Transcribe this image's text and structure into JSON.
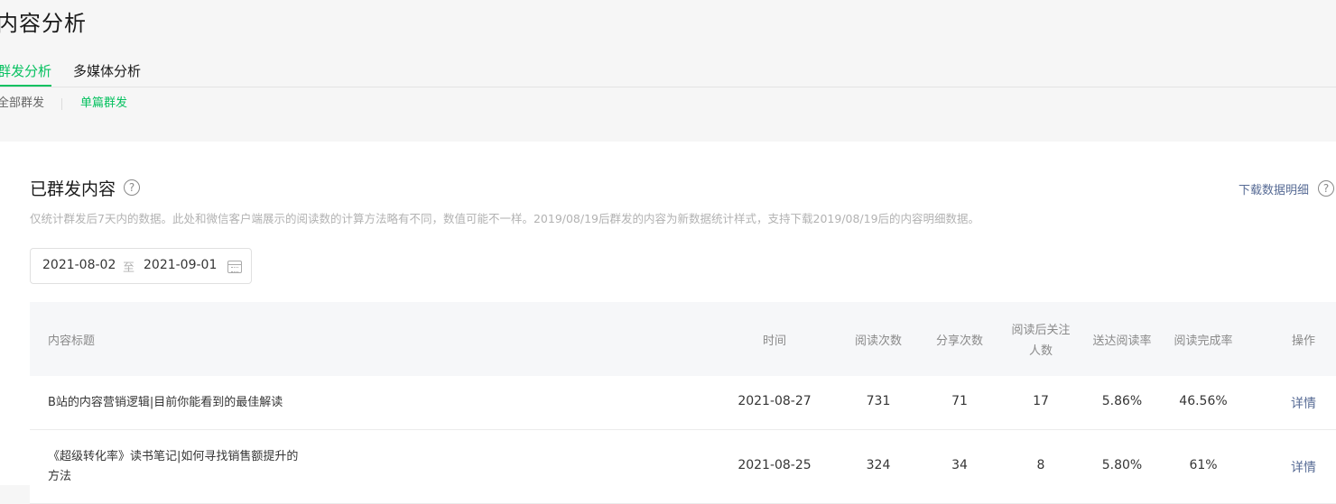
{
  "page_title": "内容分析",
  "tabs": [
    {
      "label": "群发分析",
      "active": true
    },
    {
      "label": "多媒体分析",
      "active": false
    }
  ],
  "subtabs": [
    {
      "label": "全部群发",
      "active": false
    },
    {
      "label": "单篇群发",
      "active": true
    }
  ],
  "section": {
    "title": "已群发内容",
    "download_label": "下载数据明细",
    "note": "仅统计群发后7天内的数据。此处和微信客户端展示的阅读数的计算方法略有不同，数值可能不一样。2019/08/19后群发的内容为新数据统计样式，支持下载2019/08/19后的内容明细数据。"
  },
  "date_range": {
    "start": "2021-08-02",
    "separator": "至",
    "end": "2021-09-01"
  },
  "table": {
    "headers": {
      "title": "内容标题",
      "time": "时间",
      "reads": "阅读次数",
      "shares": "分享次数",
      "follows_line1": "阅读后关注",
      "follows_line2": "人数",
      "delivery_read_rate": "送达阅读率",
      "completion_rate": "阅读完成率",
      "action": "操作"
    },
    "rows": [
      {
        "title_line1": "B站的内容营销逻辑|目前你能看到的最佳解读",
        "title_line2": "",
        "time": "2021-08-27",
        "reads": "731",
        "shares": "71",
        "follows": "17",
        "delivery_read_rate": "5.86%",
        "completion_rate": "46.56%",
        "action": "详情"
      },
      {
        "title_line1": "《超级转化率》读书笔记|如何寻找销售额提升的",
        "title_line2": "方法",
        "time": "2021-08-25",
        "reads": "324",
        "shares": "34",
        "follows": "8",
        "delivery_read_rate": "5.80%",
        "completion_rate": "61%",
        "action": "详情"
      }
    ]
  },
  "colors": {
    "accent": "#07c160",
    "link": "#576b95",
    "header_bg": "#f6f7f9"
  }
}
